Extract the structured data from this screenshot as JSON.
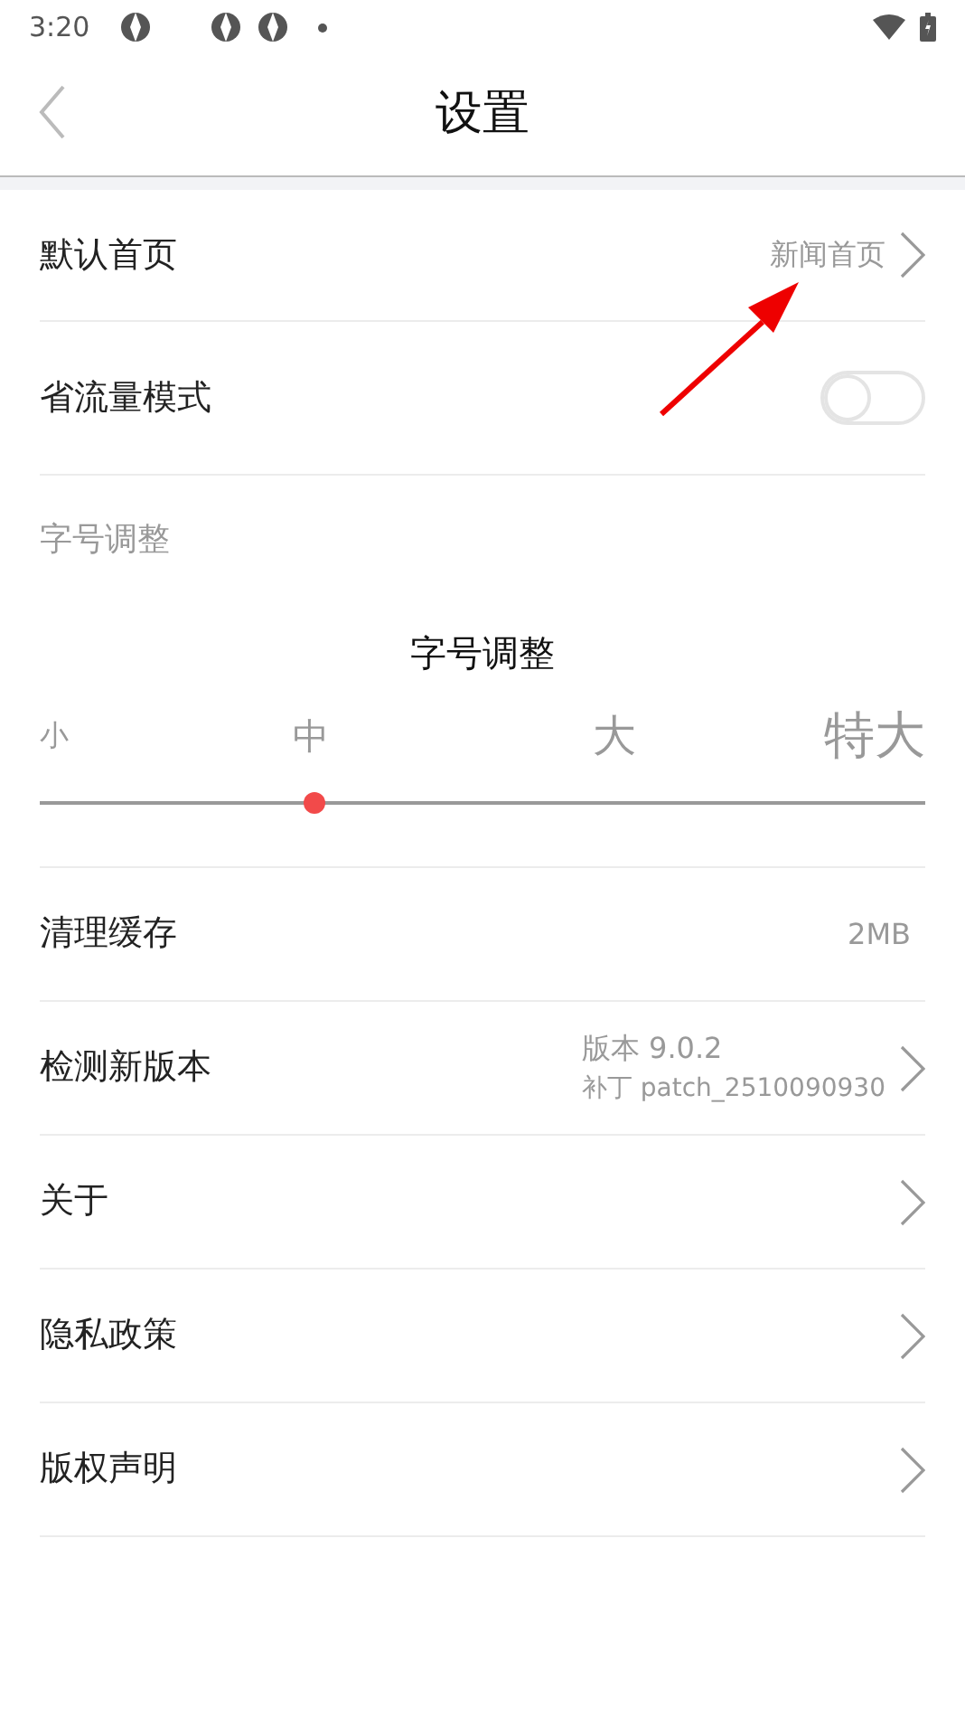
{
  "status_bar": {
    "time": "3:20"
  },
  "header": {
    "title": "设置"
  },
  "rows_top": [
    {
      "kind": "link",
      "label": "默认首页",
      "value": "新闻首页"
    },
    {
      "kind": "toggle",
      "label": "省流量模式",
      "on": false
    }
  ],
  "font_section": {
    "header": "字号调整",
    "title": "字号调整",
    "options": [
      {
        "label": "小"
      },
      {
        "label": "中"
      },
      {
        "label": "大"
      },
      {
        "label": "特大"
      }
    ],
    "level": 0.31
  },
  "rows_bottom": [
    {
      "kind": "value",
      "label": "清理缓存",
      "value": "2MB"
    },
    {
      "kind": "version",
      "label": "检测新版本",
      "value": "版本 9.0.2",
      "sub": "补丁 patch_2510090930"
    },
    {
      "kind": "link",
      "label": "关于"
    },
    {
      "kind": "link",
      "label": "隐私政策"
    },
    {
      "kind": "link",
      "label": "版权声明"
    }
  ]
}
